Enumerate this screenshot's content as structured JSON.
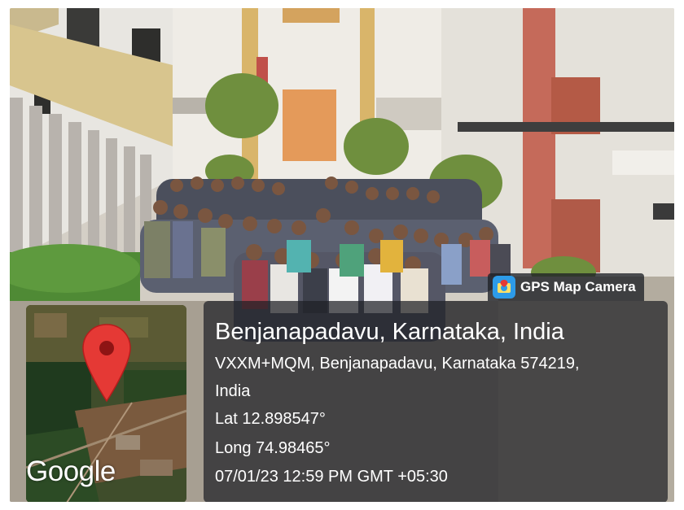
{
  "stamp": {
    "app_name": "GPS Map Camera",
    "app_icon": "gps-map-camera-app-icon",
    "location_title": "Benjanapadavu, Karnataka, India",
    "address_line1": "VXXM+MQM, Benjanapadavu, Karnataka 574219,",
    "address_line2": "India",
    "latitude": "Lat 12.898547°",
    "longitude": "Long 74.98465°",
    "datetime": "07/01/23 12:59 PM GMT +05:30"
  },
  "map": {
    "provider_logo": "Google",
    "marker_icon": "map-pin-icon",
    "marker_color": "#e53935"
  },
  "colors": {
    "panel": "#1e2026",
    "accent": "#2d9be8"
  }
}
